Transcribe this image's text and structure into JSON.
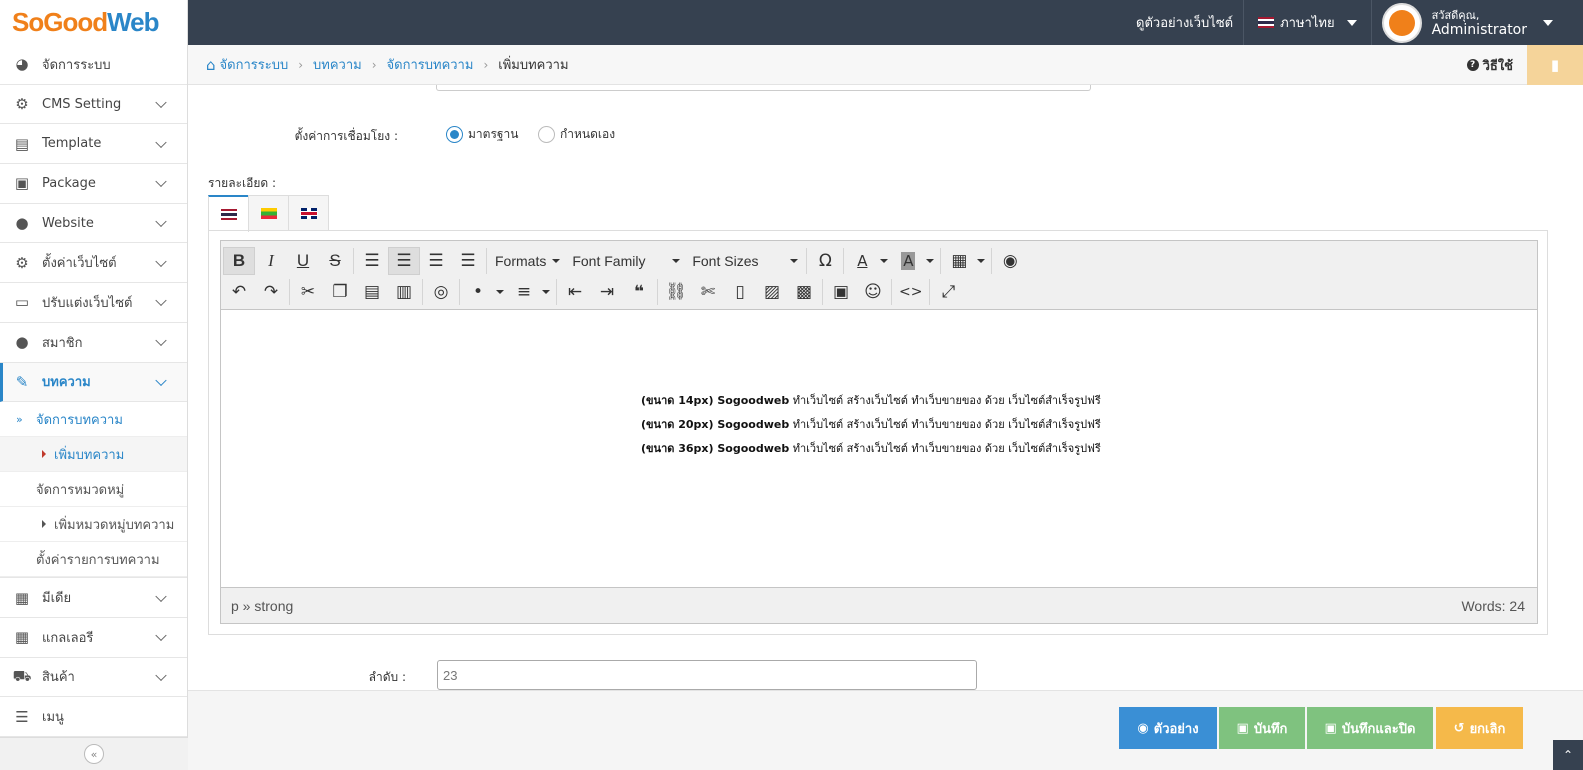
{
  "app": {
    "logo_so": "So",
    "logo_good": "Good",
    "logo_web": "Web"
  },
  "topbar": {
    "view_site": "ดูตัวอย่างเว็บไซต์",
    "language": "ภาษาไทย",
    "greeting": "สวัสดีคุณ,",
    "username": "Administrator"
  },
  "sidebar": {
    "items": [
      {
        "label": "จัดการระบบ",
        "icon": "dashboard-icon"
      },
      {
        "label": "CMS Setting",
        "icon": "gear-icon"
      },
      {
        "label": "Template",
        "icon": "template-icon"
      },
      {
        "label": "Package",
        "icon": "gift-icon"
      },
      {
        "label": "Website",
        "icon": "globe-icon"
      },
      {
        "label": "ตั้งค่าเว็บไซต์",
        "icon": "gear-icon"
      },
      {
        "label": "ปรับแต่งเว็บไซต์",
        "icon": "monitor-icon"
      },
      {
        "label": "สมาชิก",
        "icon": "user-icon"
      },
      {
        "label": "บทความ",
        "icon": "edit-icon"
      },
      {
        "label": "มีเดีย",
        "icon": "film-icon"
      },
      {
        "label": "แกลเลอรี",
        "icon": "grid-icon"
      },
      {
        "label": "สินค้า",
        "icon": "cart-icon"
      },
      {
        "label": "เมนู",
        "icon": "menu-icon"
      }
    ],
    "sub_items": [
      {
        "label": "จัดการบทความ"
      },
      {
        "label": "เพิ่มบทความ"
      },
      {
        "label": "จัดการหมวดหมู่"
      },
      {
        "label": "เพิ่มหมวดหมู่บทความ"
      },
      {
        "label": "ตั้งค่ารายการบทความ"
      }
    ]
  },
  "breadcrumb": {
    "items": [
      "จัดการระบบ",
      "บทความ",
      "จัดการบทความ",
      "เพิ่มบทความ"
    ],
    "help": "วิธีใช้"
  },
  "form": {
    "link_setting_label": "ตั้งค่าการเชื่อมโยง :",
    "link_options": [
      "มาตรฐาน",
      "กำหนดเอง"
    ],
    "link_selected": "มาตรฐาน",
    "detail_label": "รายละเอียด :",
    "order_label": "ลำดับ :",
    "order_value": "23"
  },
  "editor": {
    "dropdowns": [
      "Formats",
      "Font Family",
      "Font Sizes"
    ],
    "content_lines": [
      {
        "prefix": "(ขนาด 14px) Sogoodweb",
        "rest": " ทำเว็บไซต์ สร้างเว็บไซต์ ทำเว็บขายของ ด้วย เว็บไซต์สำเร็จรูปฟรี"
      },
      {
        "prefix": "(ขนาด 20px) Sogoodweb",
        "rest": " ทำเว็บไซต์ สร้างเว็บไซต์ ทำเว็บขายของ ด้วย เว็บไซต์สำเร็จรูปฟรี"
      },
      {
        "prefix": "(ขนาด 36px) Sogoodweb",
        "rest": " ทำเว็บไซต์ สร้างเว็บไซต์ ทำเว็บขายของ ด้วย เว็บไซต์สำเร็จรูปฟรี"
      }
    ],
    "path": "p » strong",
    "word_count": "Words: 24"
  },
  "footer": {
    "preview": "ตัวอย่าง",
    "save": "บันทึก",
    "save_close": "บันทึกและปิด",
    "cancel": "ยกเลิก"
  },
  "colors": {
    "topbar": "#364150",
    "accent": "#2a86c8",
    "logo_orange": "#f0801a",
    "btn_preview": "#3a8fd5",
    "btn_save": "#7fc27f",
    "btn_cancel": "#f5b94a"
  }
}
